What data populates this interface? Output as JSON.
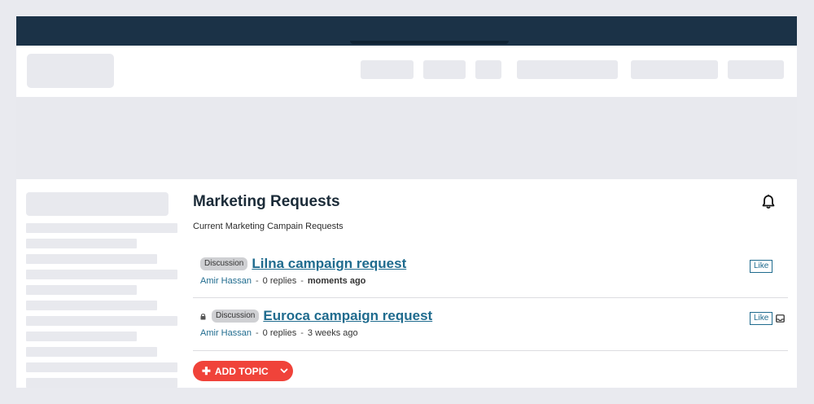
{
  "page": {
    "title": "Marketing Requests",
    "subtitle": "Current Marketing Campain Requests"
  },
  "topics": [
    {
      "badge": "Discussion",
      "title": "Lilna campaign request",
      "author": "Amir Hassan",
      "replies": "0 replies",
      "time": "moments ago",
      "like_label": "Like",
      "locked": false
    },
    {
      "badge": "Discussion",
      "title": "Euroca campaign request",
      "author": "Amir Hassan",
      "replies": "0 replies",
      "time": "3 weeks ago",
      "like_label": "Like",
      "locked": true
    }
  ],
  "add_topic": {
    "label": "ADD TOPIC"
  },
  "colors": {
    "topbar": "#1b3247",
    "link": "#1f6b8e",
    "accent": "#f0433a",
    "placeholder": "#e8e9ee"
  },
  "icons": [
    "bell-icon",
    "lock-icon",
    "inbox-icon",
    "plus-icon",
    "chevron-down-icon"
  ]
}
